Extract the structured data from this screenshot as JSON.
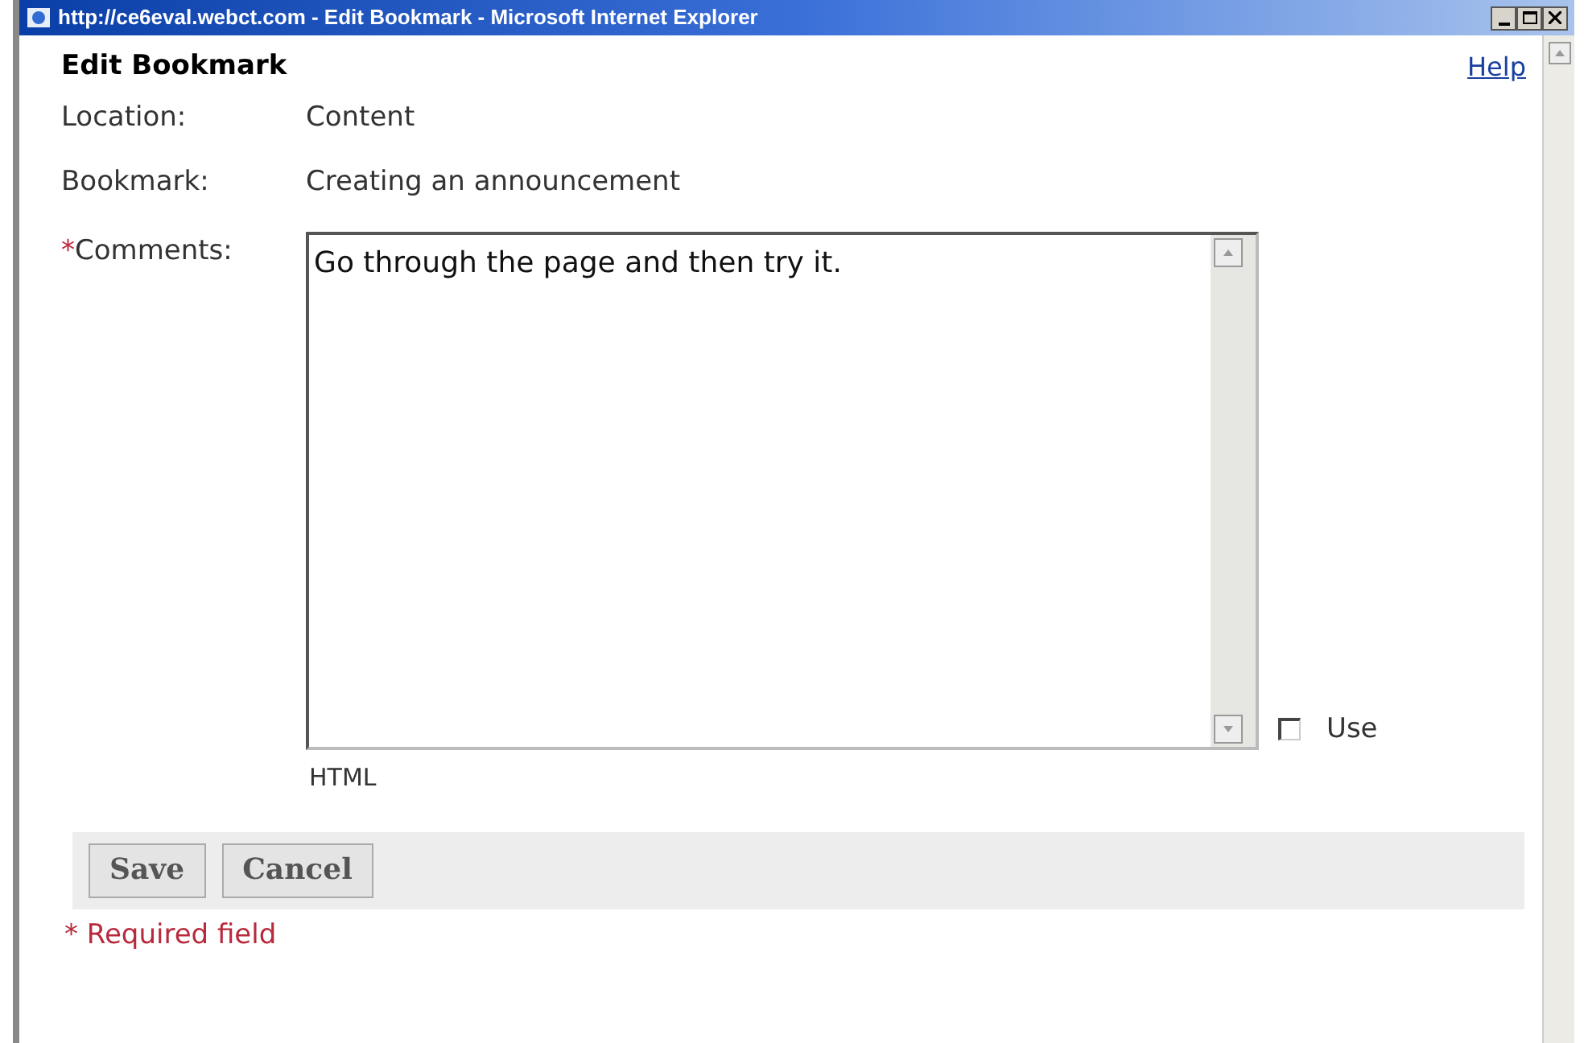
{
  "window": {
    "title": "http://ce6eval.webct.com - Edit Bookmark - Microsoft Internet Explorer"
  },
  "heading": "Edit Bookmark",
  "help_link": "Help",
  "fields": [
    {
      "label": "Location:",
      "value": "Content"
    },
    {
      "label": "Bookmark:",
      "value": "Creating an announcement"
    }
  ],
  "comments": {
    "required_mark": "*",
    "label": "Comments:",
    "value": "Go through the page and then try it."
  },
  "use_html": {
    "label_start": "Use",
    "label_end": "HTML",
    "checked": false
  },
  "buttons": [
    "Save",
    "Cancel"
  ],
  "required_note": "* Required field"
}
